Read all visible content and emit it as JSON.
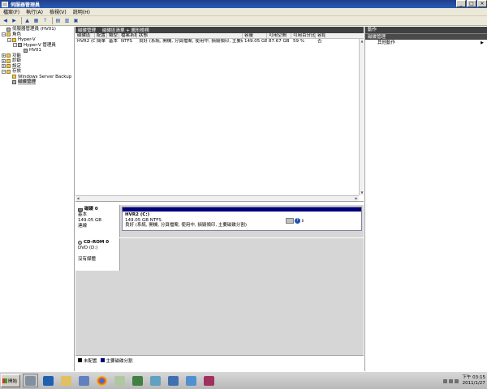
{
  "window": {
    "title": "伺服器管理員"
  },
  "menu": [
    "檔案(F)",
    "執行(A)",
    "檢視(V)",
    "說明(H)"
  ],
  "tree": [
    {
      "label": "伺服器管理員 (HV01)",
      "level": 0,
      "exp": "",
      "icon": "comp"
    },
    {
      "label": "角色",
      "level": 0,
      "exp": "−",
      "icon": "folder"
    },
    {
      "label": "Hyper-V",
      "level": 1,
      "exp": "−",
      "icon": "folder"
    },
    {
      "label": "Hyper-V 管理員",
      "level": 2,
      "exp": "−",
      "icon": "comp"
    },
    {
      "label": "HV01",
      "level": 3,
      "exp": "",
      "icon": "comp"
    },
    {
      "label": "功能",
      "level": 0,
      "exp": "+",
      "icon": "folder"
    },
    {
      "label": "診斷",
      "level": 0,
      "exp": "+",
      "icon": "folder"
    },
    {
      "label": "設定",
      "level": 0,
      "exp": "+",
      "icon": "folder"
    },
    {
      "label": "存放",
      "level": 0,
      "exp": "−",
      "icon": "folder"
    },
    {
      "label": "Windows Server Backup",
      "level": 1,
      "exp": "",
      "icon": "folder"
    },
    {
      "label": "磁碟管理",
      "level": 1,
      "exp": "",
      "icon": "comp",
      "selected": true
    }
  ],
  "center": {
    "title": "磁碟管理",
    "subtitle": "磁碟區清單 + 圖形檢視",
    "columns": [
      "磁碟區",
      "配置",
      "類型",
      "檔案系統",
      "狀態",
      "容量",
      "可用空間",
      "可用百分比",
      "容錯"
    ],
    "rows": [
      [
        "HVR2 (C:)",
        "簡單",
        "基本",
        "NTFS",
        "良好 (系統, 開機, 分頁檔案, 使用中, 損毀傾印, 主要磁碟分割)",
        "149.05 GB",
        "87.67 GB",
        "59 %",
        "否"
      ]
    ]
  },
  "disks": [
    {
      "name": "磁碟 0",
      "type": "基本",
      "size": "149.05 GB",
      "status": "連線",
      "partition": {
        "name": "HVR2  (C:)",
        "size": "149.05 GB NTFS",
        "status": "良好 (系統, 開機, 分頁檔案, 使用中, 損毀傾印, 主要磁碟分割)"
      }
    },
    {
      "name": "CD-ROM 0",
      "type": "DVD (D:)",
      "size": "",
      "status": "沒有媒體"
    }
  ],
  "legend": {
    "unallocated": "未配置",
    "primary": "主要磁碟分割"
  },
  "actions": {
    "title": "動作",
    "section": "磁碟管理",
    "item": "其他動作"
  },
  "taskbar": {
    "start": "開始",
    "time": "下午 03:15",
    "date": "2011/1/27"
  },
  "colors": {
    "primary_partition": "#00007a",
    "title_bar": "#2b5bb8"
  }
}
